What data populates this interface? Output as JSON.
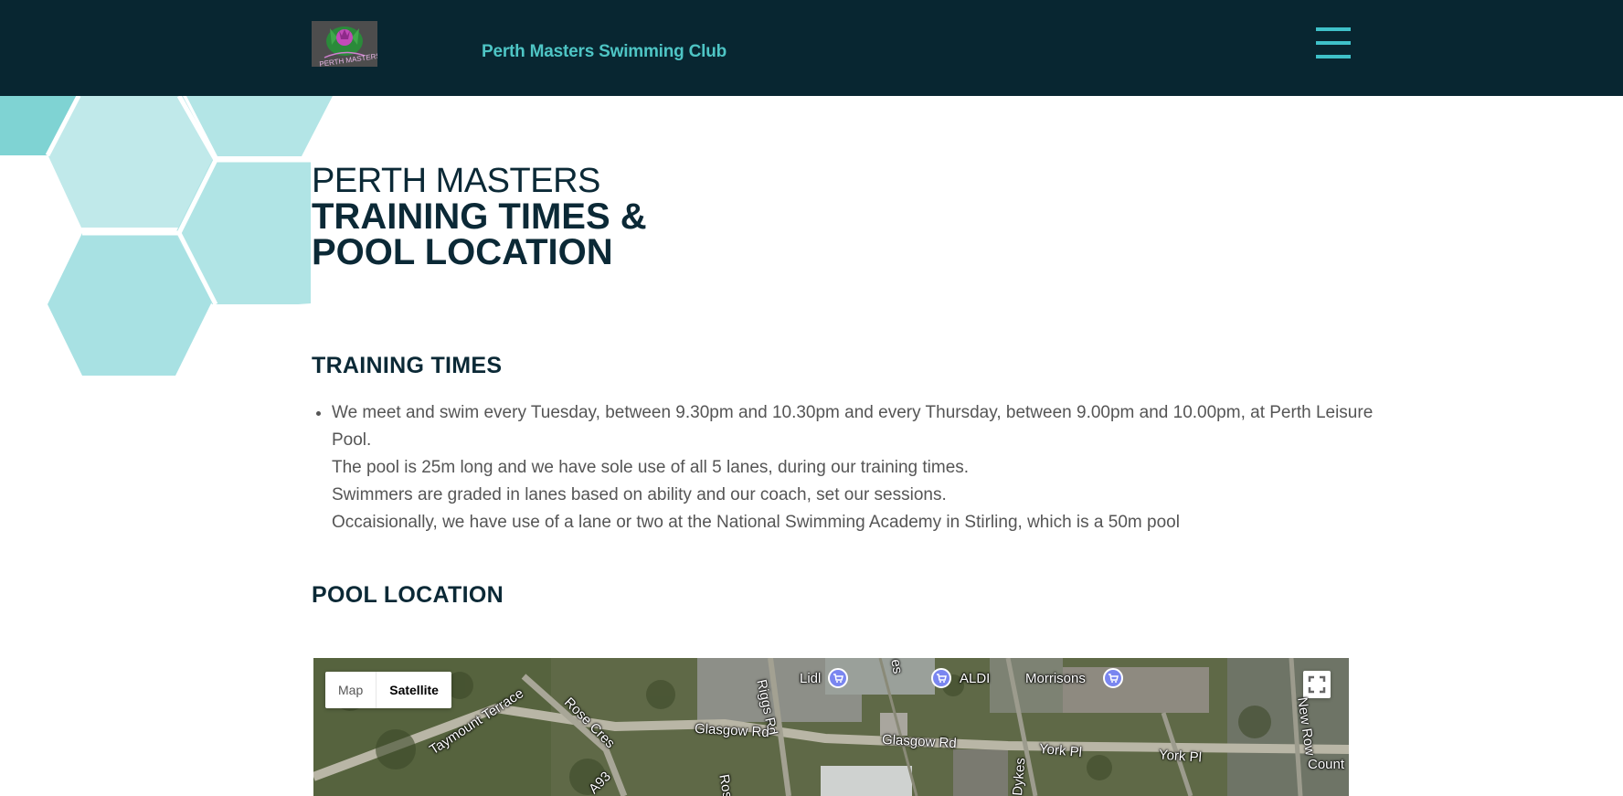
{
  "header": {
    "site_title": "Perth Masters Swimming Club",
    "logo_text": "PERTH MASTERS"
  },
  "page": {
    "heading_light": "PERTH MASTERS",
    "heading_bold_1": "TRAINING TIMES &",
    "heading_bold_2": "POOL LOCATION"
  },
  "training": {
    "title": "TRAINING TIMES",
    "lines": [
      "We meet and swim every Tuesday, between 9.30pm and 10.30pm and every Thursday, between 9.00pm and 10.00pm, at Perth Leisure Pool.",
      "The pool is 25m long and we have sole use of all 5 lanes, during our training times.",
      "Swimmers are graded in lanes based on ability and our coach, set our sessions.",
      "Occaisionally, we have use of a lane or two at the National Swimming Academy in Stirling, which is a 50m pool"
    ]
  },
  "location": {
    "title": "POOL LOCATION"
  },
  "map": {
    "type_map": "Map",
    "type_satellite": "Satellite",
    "labels": {
      "lidl": "Lidl",
      "aldi": "ALDI",
      "morrisons": "Morrisons",
      "riggs_rd": "Riggs Rd",
      "glasgow_rd_1": "Glasgow Rd",
      "glasgow_rd_2": "Glasgow Rd",
      "taymount": "Taymount Terrace",
      "rose_cres": "Rose Cres",
      "a93": "A93",
      "york_pl_1": "York Pl",
      "york_pl_2": "York Pl",
      "new_row": "New Row",
      "count": "Count",
      "ros": "Ros",
      "dykes": "Dykes",
      "es": "es"
    }
  },
  "colors": {
    "header_bg": "#082631",
    "accent": "#4ec5c5",
    "heading": "#0b2936",
    "hex_light": "#c0e9ea",
    "hex_mid": "#a8e3e4",
    "hex_dark": "#7fd3d3"
  }
}
